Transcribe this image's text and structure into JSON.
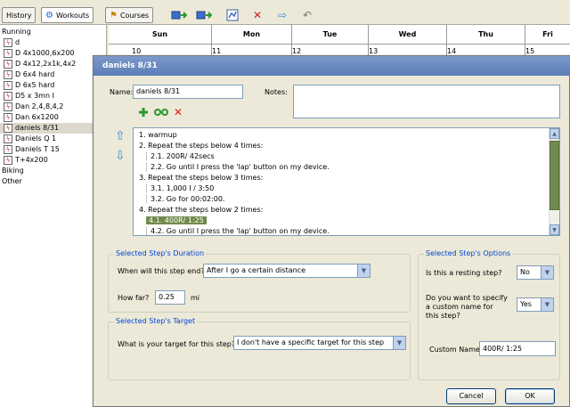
{
  "toolbar": {
    "history_label": "History",
    "workouts_label": "Workouts",
    "courses_label": "Courses"
  },
  "sidebar": {
    "groups": [
      "Running",
      "Biking",
      "Other"
    ],
    "items": [
      {
        "label": "d"
      },
      {
        "label": "D 4x1000,6x200"
      },
      {
        "label": "D 4x12,2x1k,4x2"
      },
      {
        "label": "D 6x4 hard"
      },
      {
        "label": "D 6x5 hard"
      },
      {
        "label": "D5 x  3mn I"
      },
      {
        "label": "Dan 2,4,8,4,2"
      },
      {
        "label": "Dan 6x1200"
      },
      {
        "label": "daniels 8/31"
      },
      {
        "label": "Daniels Q 1"
      },
      {
        "label": "Daniels T 15"
      },
      {
        "label": "T+4x200"
      }
    ]
  },
  "calendar": {
    "days": [
      "Sun",
      "Mon",
      "Tue",
      "Wed",
      "Thu",
      "Fri"
    ],
    "dates": [
      "10",
      "11",
      "12",
      "13",
      "14",
      "15"
    ]
  },
  "dialog": {
    "title": "daniels 8/31",
    "name_label": "Name:",
    "name_value": "daniels 8/31",
    "notes_label": "Notes:",
    "notes_value": "",
    "steps": [
      {
        "text": "1. warmup",
        "indent": 0
      },
      {
        "text": "2. Repeat the steps below 4 times:",
        "indent": 0
      },
      {
        "text": "2.1. 200R/ 42secs",
        "indent": 1
      },
      {
        "text": "2.2. Go until I press the 'lap' button on my device.",
        "indent": 1
      },
      {
        "text": "3. Repeat the steps below 3 times:",
        "indent": 0
      },
      {
        "text": "3.1. 1,000 I / 3:50",
        "indent": 1
      },
      {
        "text": "3.2. Go for 00:02:00.",
        "indent": 1
      },
      {
        "text": "4. Repeat the steps below 2 times:",
        "indent": 0
      },
      {
        "text": "4.1. 400R/ 1:25",
        "indent": 1,
        "selected": true
      },
      {
        "text": "4.2. Go until I press the 'lap' button on my device.",
        "indent": 1
      }
    ],
    "duration": {
      "title": "Selected Step's Duration",
      "end_label": "When will this step end?",
      "end_value": "After I go a certain distance",
      "how_far_label": "How far?",
      "how_far_value": "0.25",
      "unit": "mi"
    },
    "target": {
      "title": "Selected Step's Target",
      "label": "What is your target for this step?",
      "value": "I don't have a specific target for this step"
    },
    "options": {
      "title": "Selected Step's Options",
      "resting_label": "Is this a resting step?",
      "resting_value": "No",
      "custom_q": "Do you want to specify a custom name for this step?",
      "custom_value": "Yes",
      "custom_name_label": "Custom Name:",
      "custom_name_value": "400R/ 1:25"
    },
    "cancel_label": "Cancel",
    "ok_label": "OK"
  },
  "colors": {
    "title_bar": "#5b7db8",
    "group_title": "#0046d5",
    "selected_step": "#6f8a4d",
    "delete_red": "#d02020",
    "add_green": "#2a9a2a",
    "arrow_blue": "#3a8fd8"
  }
}
